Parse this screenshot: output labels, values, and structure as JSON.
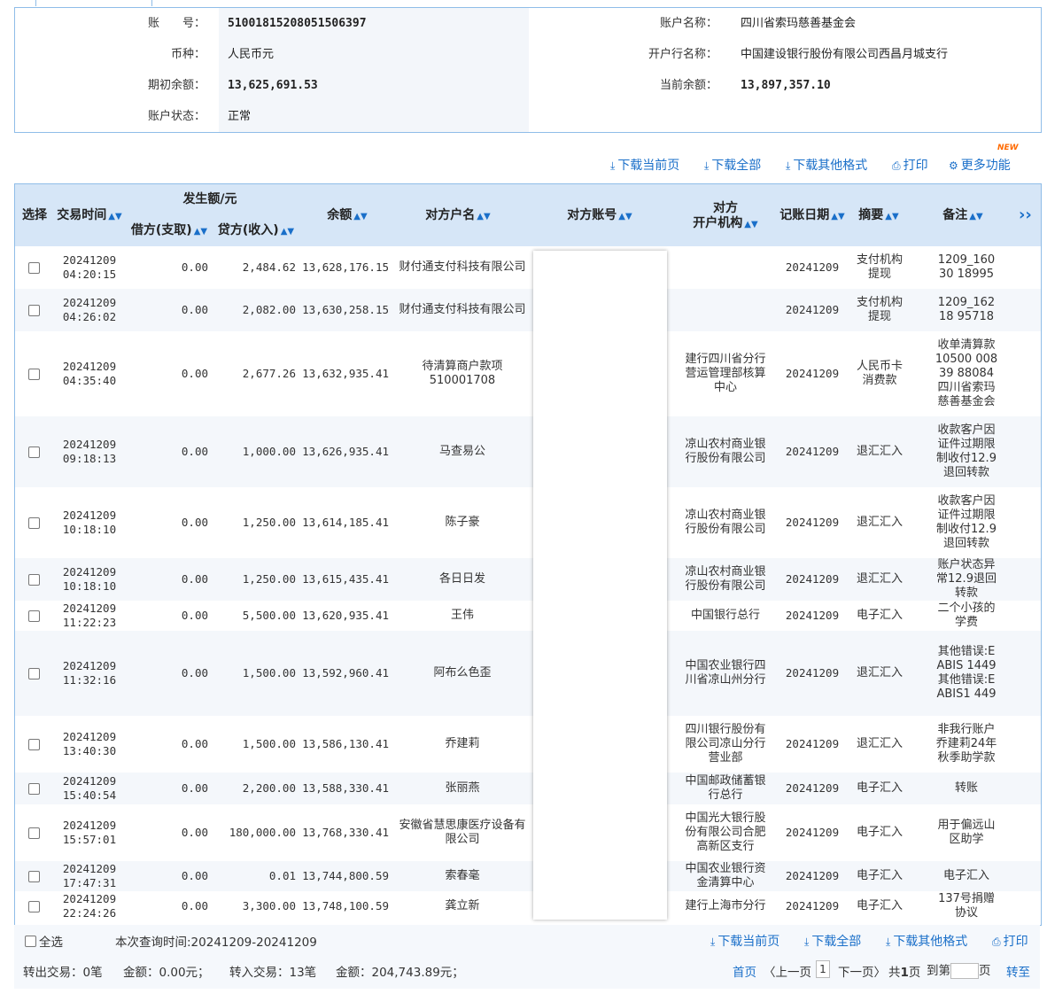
{
  "account": {
    "account_no_label": "账　　号：",
    "account_no": "51001815208051506397",
    "account_name_label": "账户名称：",
    "account_name": "四川省索玛慈善基金会",
    "currency_label": "币种：",
    "currency": "人民币元",
    "bank_label": "开户行名称：",
    "bank": "中国建设银行股份有限公司西昌月城支行",
    "opening_balance_label": "期初余额：",
    "opening_balance": "13,625,691.53",
    "current_balance_label": "当前余额：",
    "current_balance": "13,897,357.10",
    "status_label": "账户状态：",
    "status": "正常"
  },
  "toolbar": {
    "download_page": "下载当前页",
    "download_all": "下载全部",
    "download_other": "下载其他格式",
    "print": "打印",
    "more": "更多功能",
    "new_badge": "NEW"
  },
  "columns": {
    "select": "选择",
    "time": "交易时间",
    "amount_group": "发生额/元",
    "debit": "借方(支取)",
    "credit": "贷方(收入)",
    "balance": "余额",
    "party_name": "对方户名",
    "party_account": "对方账号",
    "party_bank_1": "对方",
    "party_bank_2": "开户机构",
    "post_date": "记账日期",
    "summary": "摘要",
    "remark": "备注"
  },
  "rows": [
    {
      "date": "20241209",
      "time": "04:20:15",
      "debit": "0.00",
      "credit": "2,484.62",
      "balance": "13,628,176.15",
      "name": "财付通支付科技有限公司",
      "bank": "",
      "post": "20241209",
      "summary": "支付机构提现",
      "remark": "1209_16030 18995"
    },
    {
      "date": "20241209",
      "time": "04:26:02",
      "debit": "0.00",
      "credit": "2,082.00",
      "balance": "13,630,258.15",
      "name": "财付通支付科技有限公司",
      "bank": "",
      "post": "20241209",
      "summary": "支付机构提现",
      "remark": "1209_16218 95718"
    },
    {
      "date": "20241209",
      "time": "04:35:40",
      "debit": "0.00",
      "credit": "2,677.26",
      "balance": "13,632,935.41",
      "name": "待清算商户款项510001708",
      "bank": "建行四川省分行营运管理部核算中心",
      "post": "20241209",
      "summary": "人民币卡消费款",
      "remark": "收单清算款10500 00839 88084 四川省索玛慈善基金会"
    },
    {
      "date": "20241209",
      "time": "09:18:13",
      "debit": "0.00",
      "credit": "1,000.00",
      "balance": "13,626,935.41",
      "name": "马查易公",
      "bank": "凉山农村商业银行股份有限公司",
      "post": "20241209",
      "summary": "退汇汇入",
      "remark": "收款客户因证件过期限制收付12.9退回转款"
    },
    {
      "date": "20241209",
      "time": "10:18:10",
      "debit": "0.00",
      "credit": "1,250.00",
      "balance": "13,614,185.41",
      "name": "陈子豪",
      "bank": "凉山农村商业银行股份有限公司",
      "post": "20241209",
      "summary": "退汇汇入",
      "remark": "收款客户因证件过期限制收付12.9退回转款"
    },
    {
      "date": "20241209",
      "time": "10:18:10",
      "debit": "0.00",
      "credit": "1,250.00",
      "balance": "13,615,435.41",
      "name": "各日日发",
      "bank": "凉山农村商业银行股份有限公司",
      "post": "20241209",
      "summary": "退汇汇入",
      "remark": "账户状态异常12.9退回转款"
    },
    {
      "date": "20241209",
      "time": "11:22:23",
      "debit": "0.00",
      "credit": "5,500.00",
      "balance": "13,620,935.41",
      "name": "王伟",
      "bank": "中国银行总行",
      "post": "20241209",
      "summary": "电子汇入",
      "remark": "二个小孩的学费"
    },
    {
      "date": "20241209",
      "time": "11:32:16",
      "debit": "0.00",
      "credit": "1,500.00",
      "balance": "13,592,960.41",
      "name": "阿布么色歪",
      "bank": "中国农业银行四川省凉山州分行",
      "post": "20241209",
      "summary": "退汇汇入",
      "remark": "其他错误:EABIS 1449其他错误:EABIS1 449"
    },
    {
      "date": "20241209",
      "time": "13:40:30",
      "debit": "0.00",
      "credit": "1,500.00",
      "balance": "13,586,130.41",
      "name": "乔建莉",
      "bank": "四川银行股份有限公司凉山分行营业部",
      "post": "20241209",
      "summary": "退汇汇入",
      "remark": "非我行账户乔建莉24年秋季助学款"
    },
    {
      "date": "20241209",
      "time": "15:40:54",
      "debit": "0.00",
      "credit": "2,200.00",
      "balance": "13,588,330.41",
      "name": "张丽燕",
      "bank": "中国邮政储蓄银行总行",
      "post": "20241209",
      "summary": "电子汇入",
      "remark": "转账"
    },
    {
      "date": "20241209",
      "time": "15:57:01",
      "debit": "0.00",
      "credit": "180,000.00",
      "balance": "13,768,330.41",
      "name": "安徽省慧思康医疗设备有限公司",
      "bank": "中国光大银行股份有限公司合肥高新区支行",
      "post": "20241209",
      "summary": "电子汇入",
      "remark": "用于偏远山区助学"
    },
    {
      "date": "20241209",
      "time": "17:47:31",
      "debit": "0.00",
      "credit": "0.01",
      "balance": "13,744,800.59",
      "name": "索春毫",
      "bank": "中国农业银行资金清算中心",
      "post": "20241209",
      "summary": "电子汇入",
      "remark": "电子汇入"
    },
    {
      "date": "20241209",
      "time": "22:24:26",
      "debit": "0.00",
      "credit": "3,300.00",
      "balance": "13,748,100.59",
      "name": "龚立新",
      "bank": "建行上海市分行",
      "post": "20241209",
      "summary": "电子汇入",
      "remark": "137号捐赠协议"
    }
  ],
  "footer": {
    "select_all": "全选",
    "query_time": "本次查询时间:20241209-20241209",
    "download_page": "下载当前页",
    "download_all": "下载全部",
    "download_other": "下载其他格式",
    "print": "打印",
    "out_tx": "转出交易：0笔",
    "out_amt": "金额：0.00元；",
    "in_tx": "转入交易：13笔",
    "in_amt": "金额：204,743.89元；",
    "first": "首页",
    "prev": "〈上一页",
    "page": "1",
    "next": "下一页〉",
    "total_pre": "共",
    "total_num": "1",
    "total_post": "页",
    "jump_pre": "到第",
    "jump_post": "页",
    "go": "转至"
  }
}
